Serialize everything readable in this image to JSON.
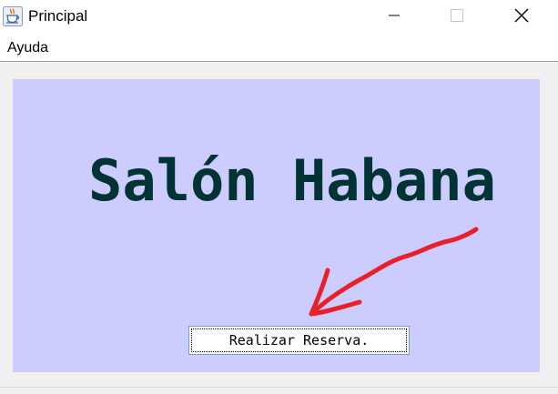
{
  "window": {
    "title": "Principal",
    "icon": "java-cup-icon",
    "controls": [
      "minimize-icon",
      "maximize-icon",
      "close-icon"
    ]
  },
  "menubar": {
    "items": [
      {
        "label": "Ayuda"
      }
    ]
  },
  "main": {
    "headline": "Salón Habana",
    "reserve_button_label": "Realizar Reserva.",
    "annotation": "red-arrow-pointing-to-button"
  },
  "colors": {
    "content_background": "#ccccff",
    "headline": "#003333",
    "annotation_arrow": "#e8202a"
  }
}
